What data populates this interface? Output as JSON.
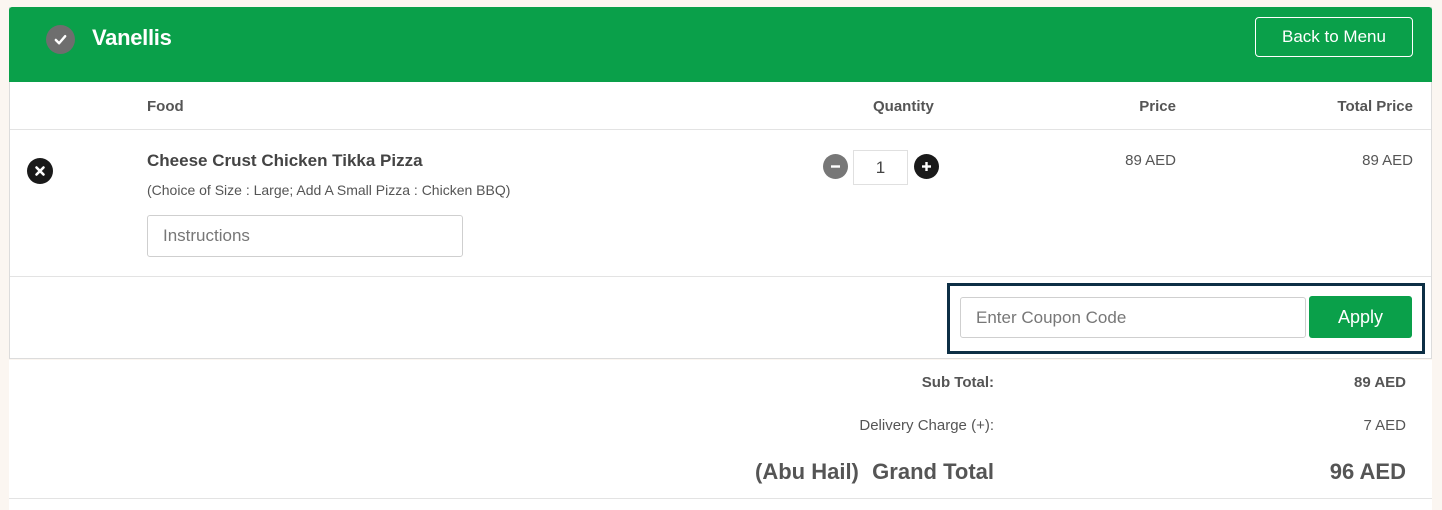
{
  "header": {
    "restaurant_name": "Vanellis",
    "back_button_label": "Back to Menu"
  },
  "table": {
    "columns": {
      "food": "Food",
      "quantity": "Quantity",
      "price": "Price",
      "total_price": "Total Price"
    },
    "items": [
      {
        "name": "Cheese Crust Chicken Tikka Pizza",
        "options": "(Choice of Size : Large; Add A Small Pizza : Chicken BBQ)",
        "instructions_placeholder": "Instructions",
        "quantity": "1",
        "price": "89 AED",
        "total_price": "89 AED"
      }
    ]
  },
  "coupon": {
    "placeholder": "Enter Coupon Code",
    "apply_label": "Apply"
  },
  "summary": {
    "sub_total_label": "Sub Total:",
    "sub_total_value": "89 AED",
    "delivery_label": "Delivery Charge (+):",
    "delivery_value": "7 AED",
    "area": "(Abu Hail)",
    "grand_total_label": "Grand Total",
    "grand_total_value": "96 AED"
  },
  "icons": {
    "check": "check-icon",
    "remove": "close-icon",
    "minus": "minus-icon",
    "plus": "plus-icon"
  },
  "colors": {
    "brand_green": "#0aa04a",
    "highlight_border": "#0d2f45"
  }
}
